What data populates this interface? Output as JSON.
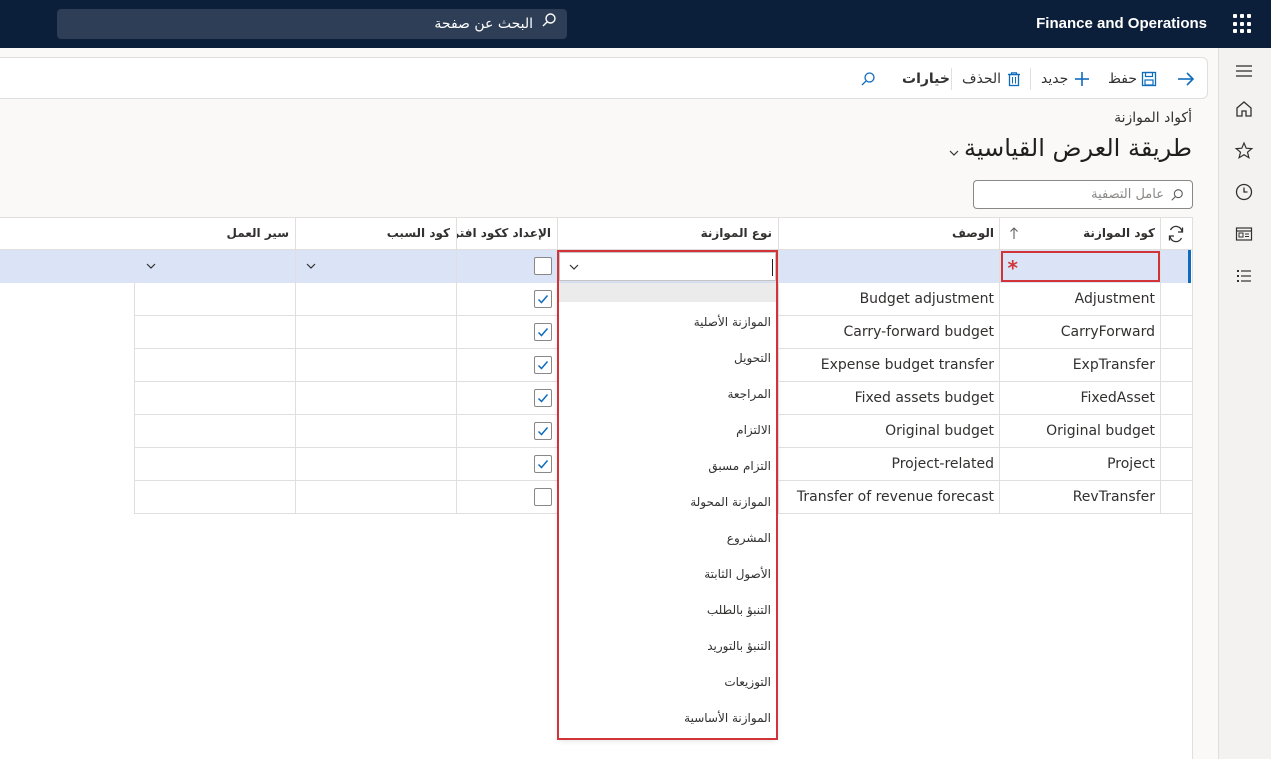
{
  "topbar": {
    "app_title": "Finance and Operations",
    "search_placeholder": "البحث عن صفحة"
  },
  "actions": {
    "save": "حفظ",
    "new": "جديد",
    "delete": "الحذف",
    "options": "خيارات"
  },
  "page": {
    "breadcrumb": "أكواد الموازنة",
    "title": "طريقة العرض القياسية",
    "filter_placeholder": "عامل التصفية"
  },
  "grid": {
    "columns": {
      "code": "كود الموازنة",
      "description": "الوصف",
      "type": "نوع الموازنة",
      "default_setup": "الإعداد ككود افتر...",
      "reason_code": "كود السبب",
      "workflow": "سير العمل"
    },
    "rows": [
      {
        "code": "Adjustment",
        "description": "Budget adjustment",
        "default": true
      },
      {
        "code": "CarryForward",
        "description": "Carry-forward budget",
        "default": true
      },
      {
        "code": "ExpTransfer",
        "description": "Expense budget transfer",
        "default": true
      },
      {
        "code": "FixedAsset",
        "description": "Fixed assets budget",
        "default": true
      },
      {
        "code": "Original budget",
        "description": "Original budget",
        "default": true
      },
      {
        "code": "Project",
        "description": "Project-related",
        "default": true
      },
      {
        "code": "RevTransfer",
        "description": "Transfer of revenue forecast",
        "default": false
      }
    ],
    "new_row": {
      "required_marker": "*"
    }
  },
  "dropdown": {
    "options": [
      "الموازنة الأصلية",
      "التحويل",
      "المراجعة",
      "الالتزام",
      "التزام مسبق",
      "الموازنة المحولة",
      "المشروع",
      "الأصول الثابتة",
      "التنبؤ بالطلب",
      "التنبؤ بالتوريد",
      "التوزيعات",
      "الموازنة الأساسية"
    ]
  },
  "colors": {
    "topbar": "#0b1f3a",
    "accent": "#0f6cbd",
    "error": "#d13438",
    "selected_row": "#dbe4f7"
  }
}
